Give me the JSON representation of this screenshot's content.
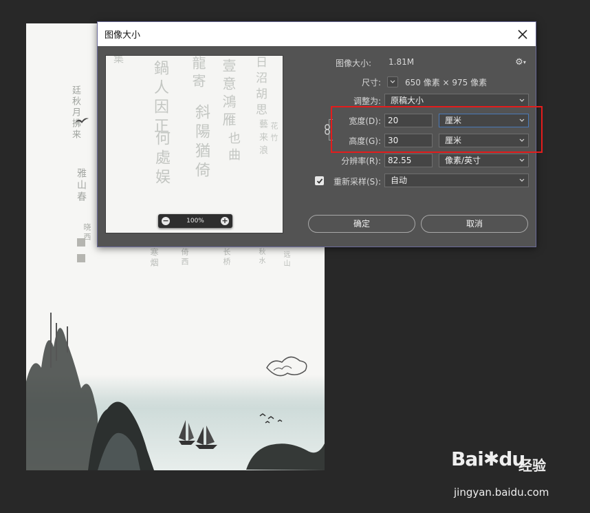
{
  "dialog": {
    "title": "图像大小",
    "image_size_label": "图像大小:",
    "image_size_value": "1.81M",
    "dimensions_label": "尺寸:",
    "dimensions_value": "650 像素 × 975 像素",
    "fit_to_label": "调整为:",
    "fit_to_value": "原稿大小",
    "width_label": "宽度(D):",
    "width_value": "20",
    "width_unit": "厘米",
    "height_label": "高度(G):",
    "height_value": "30",
    "height_unit": "厘米",
    "resolution_label": "分辨率(R):",
    "resolution_value": "82.55",
    "resolution_unit": "像素/英寸",
    "resample_label": "重新采样(S):",
    "resample_checked": true,
    "resample_value": "自动",
    "preview_zoom": "100%",
    "ok_label": "确定",
    "cancel_label": "取消"
  },
  "watermark": {
    "logo_text_1": "Bai",
    "logo_text_2": "du",
    "brand_suffix": "经验",
    "url": "jingyan.baidu.com"
  },
  "colors": {
    "workspace_bg": "#282828",
    "dialog_bg": "#535353",
    "field_bg": "#454545",
    "highlight": "#e41c1c",
    "focus_border": "#4a7ab8"
  },
  "icons": {
    "close": "close-icon",
    "gear": "gear-icon",
    "link": "chain-link-icon",
    "checkbox": "checkmark-icon",
    "zoom_out": "minus-circle-icon",
    "zoom_in": "plus-circle-icon"
  }
}
